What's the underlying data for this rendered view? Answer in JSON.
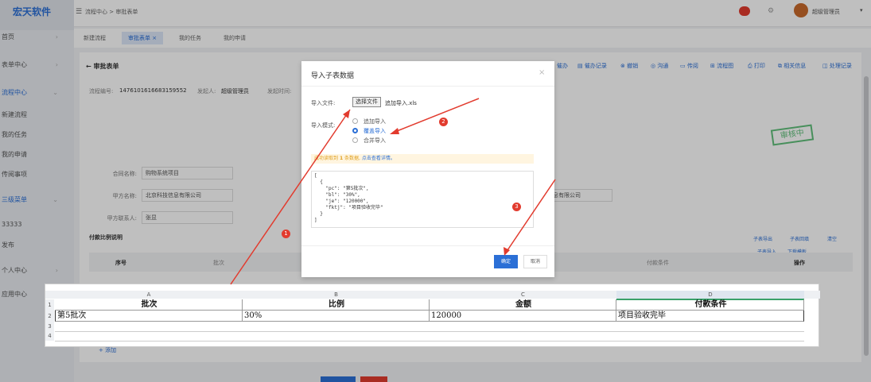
{
  "app": {
    "brand": "宏天软件"
  },
  "sidebar": {
    "items": [
      {
        "label": "首页"
      },
      {
        "label": "表单中心"
      },
      {
        "label": "流程中心"
      },
      {
        "label": "新建流程"
      },
      {
        "label": "我的任务"
      },
      {
        "label": "我的申请"
      },
      {
        "label": "传阅事项"
      },
      {
        "label": "三级菜单"
      },
      {
        "label": "33333"
      },
      {
        "label": "发布"
      },
      {
        "label": "个人中心"
      },
      {
        "label": "应用中心"
      }
    ]
  },
  "header": {
    "breadcrumb": "流程中心 > 审批表单",
    "user": "超级管理员"
  },
  "tabs": [
    {
      "label": "新建流程"
    },
    {
      "label": "审批表单"
    },
    {
      "label": "我的任务"
    },
    {
      "label": "我的申请"
    }
  ],
  "page": {
    "back_title": "审批表单",
    "flow_no_label": "流程编号:",
    "flow_no": "1476101616683159552",
    "initiator_label": "发起人:",
    "initiator": "超级管理员",
    "time_label": "发起时间:",
    "toolbar": [
      "催办",
      "催办记录",
      "撤销",
      "沟通",
      "传阅",
      "流程图",
      "打印",
      "相关信息",
      "处理记录"
    ],
    "stamp": "审核中",
    "contract_name_label": "合同名称:",
    "contract_name": "购物系统项目",
    "party_a_label": "甲方名称:",
    "party_a": "北京科技信息有限公司",
    "party_b_tail": "息有限公司",
    "contact_label": "甲方联系人:",
    "contact": "张显",
    "section_title": "付款比例说明",
    "sub_actions": [
      "子表导出",
      "子表回填",
      "清空",
      "子表导入",
      "下载模板"
    ],
    "table_headers": [
      "序号",
      "批次",
      "付款条件",
      "操作"
    ],
    "add_link": "+ 添加"
  },
  "modal": {
    "title": "导入子表数据",
    "file_label": "导入文件:",
    "choose_btn": "选择文件",
    "file_name": "追加导入.xls",
    "mode_label": "导入模式:",
    "modes": [
      "追加导入",
      "覆盖导入",
      "合并导入"
    ],
    "selected_mode": "覆盖导入",
    "info_prefix": "成功读取到",
    "info_count": "1",
    "info_suffix": "条数据,",
    "info_link": "点击查看详情。",
    "json_lines": [
      "[",
      "  {",
      "    \"pc\": \"第5批次\",",
      "    \"bl\": \"30%\",",
      "    \"je\": \"120000\",",
      "    \"fktj\": \"项目验收完毕\"",
      "  }",
      "]"
    ],
    "ok": "确定",
    "cancel": "取消"
  },
  "excel": {
    "col_letters": [
      "A",
      "B",
      "C",
      "D"
    ],
    "headers": [
      "批次",
      "比例",
      "金额",
      "付款条件"
    ],
    "row": [
      "第5批次",
      "30%",
      "120000",
      "项目验收完毕"
    ],
    "row_numbers": [
      "1",
      "2",
      "3",
      "4"
    ]
  },
  "markers": [
    "1",
    "2",
    "3"
  ],
  "colors": {
    "accent": "#2b6fd6",
    "annotation": "#e23b2e",
    "approved": "#5fbf7a"
  }
}
